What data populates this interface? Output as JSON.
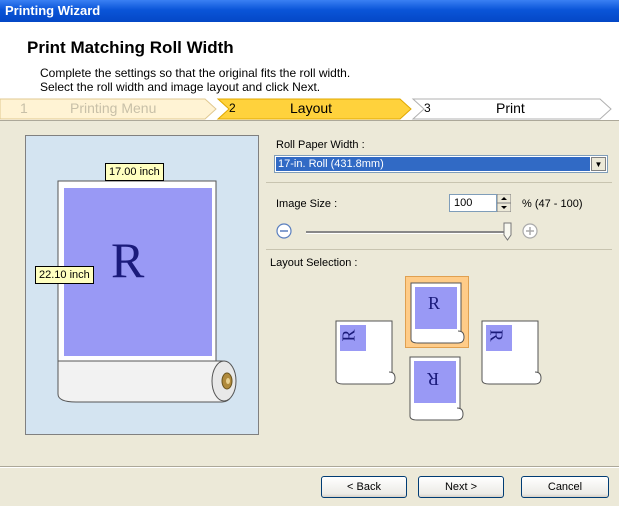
{
  "window": {
    "title": "Printing Wizard"
  },
  "header": {
    "title": "Print Matching Roll Width",
    "line1": "Complete the settings so that the original fits the roll width.",
    "line2": "Select the roll width and image layout and click Next."
  },
  "steps": [
    {
      "num": "1",
      "label": "Printing Menu",
      "state": "done"
    },
    {
      "num": "2",
      "label": "Layout",
      "state": "current"
    },
    {
      "num": "3",
      "label": "Print",
      "state": "upcoming"
    }
  ],
  "preview": {
    "width_label": "17.00 inch",
    "height_label": "22.10 inch",
    "glyph": "R"
  },
  "roll_paper": {
    "label": "Roll Paper Width :",
    "selected": "17-in. Roll (431.8mm)"
  },
  "image_size": {
    "label": "Image Size :",
    "value": "100",
    "range_text": "% (47 - 100)",
    "slider_fraction": 1.0
  },
  "layout_selection": {
    "label": "Layout Selection :",
    "glyph": "R",
    "options": [
      "rotate-left",
      "normal",
      "rotate-right",
      "upside-down"
    ],
    "selected": "normal"
  },
  "buttons": {
    "back": "< Back",
    "next": "Next >",
    "cancel": "Cancel"
  },
  "colors": {
    "title_bar": "#0a55d8",
    "preview_bg": "#d4e4f1",
    "paper_image": "#9999f5",
    "step_current": "#ffd23c",
    "selected_option": "#ffcc88"
  }
}
